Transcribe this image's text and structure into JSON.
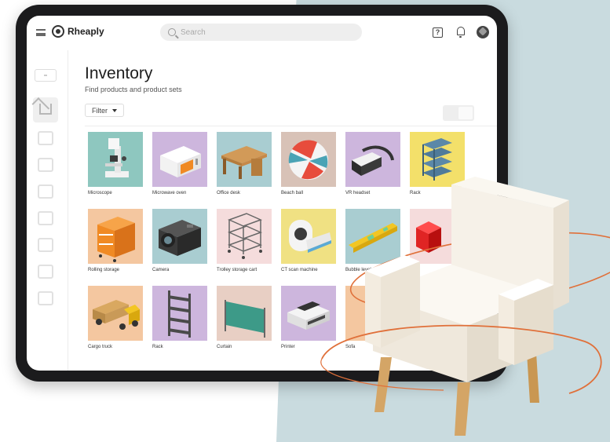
{
  "app": {
    "brand": "Rheaply",
    "search_placeholder": "Search"
  },
  "icons": [
    "menu-icon",
    "logo-icon",
    "search-icon",
    "help-icon",
    "bell-icon",
    "avatar"
  ],
  "sidebar": {
    "items": [
      "add",
      "home",
      "store",
      "chat",
      "cart",
      "basket",
      "tag",
      "chart",
      "settings"
    ]
  },
  "page": {
    "title": "Inventory",
    "subtitle": "Find products and product sets",
    "filter_label": "Filter"
  },
  "products": [
    {
      "label": "Microscope",
      "bg": "#8ec7bf"
    },
    {
      "label": "Microwave oven",
      "bg": "#cdb6dd"
    },
    {
      "label": "Office desk",
      "bg": "#a9cdd1"
    },
    {
      "label": "Beach ball",
      "bg": "#d8c2b7"
    },
    {
      "label": "VR headset",
      "bg": "#cdb6dd"
    },
    {
      "label": "Rack",
      "bg": "#f3e06a"
    },
    {
      "label": "Rolling storage",
      "bg": "#f4c7a0"
    },
    {
      "label": "Camera",
      "bg": "#a9cdd1"
    },
    {
      "label": "Trolley storage cart",
      "bg": "#f5dcdc"
    },
    {
      "label": "CT scan machine",
      "bg": "#f0e183"
    },
    {
      "label": "Bubble level",
      "bg": "#a9cdd1"
    },
    {
      "label": "",
      "bg": "#f5dcdc"
    },
    {
      "label": "Cargo truck",
      "bg": "#f4c7a0"
    },
    {
      "label": "Rack",
      "bg": "#cdb6dd"
    },
    {
      "label": "Curtain",
      "bg": "#e8cfc4"
    },
    {
      "label": "Printer",
      "bg": "#cdb6dd"
    },
    {
      "label": "Sofa",
      "bg": "#f4c7a0"
    }
  ],
  "colors": {
    "tablet_frame": "#1b1b1d",
    "backdrop": "#c9dbdf",
    "chair": "#f6f1e8",
    "orbit": "#e0703a"
  }
}
